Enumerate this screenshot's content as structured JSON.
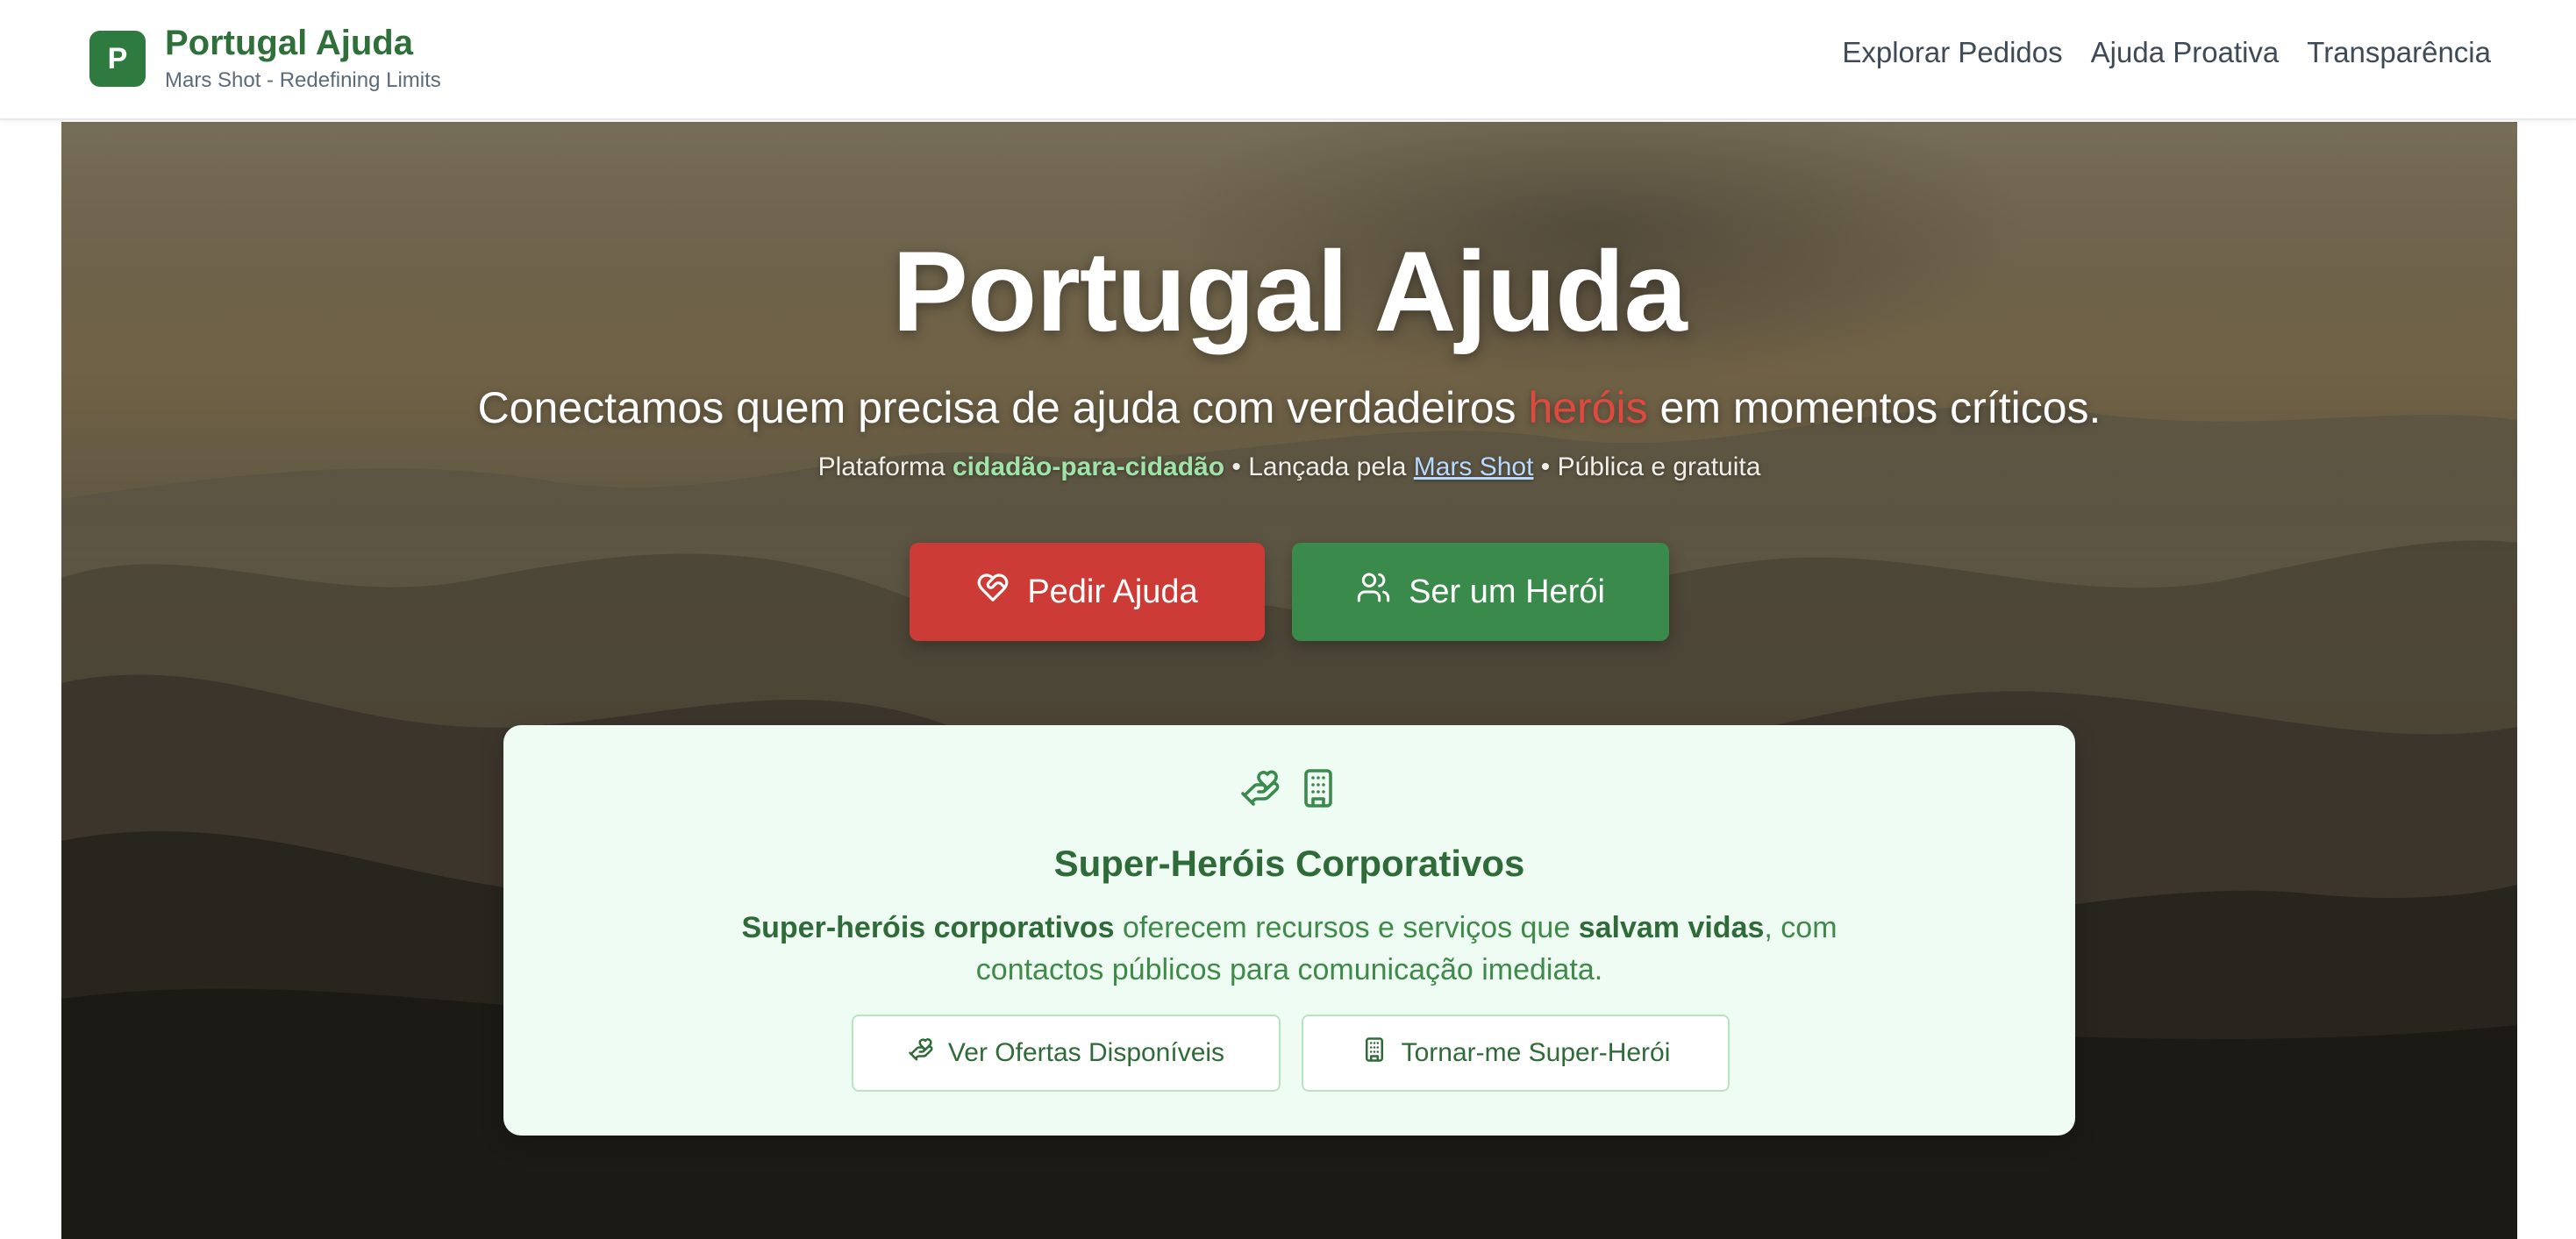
{
  "header": {
    "logo_letter": "P",
    "brand_title": "Portugal Ajuda",
    "brand_subtitle": "Mars Shot - Redefining Limits",
    "nav": [
      "Explorar Pedidos",
      "Ajuda Proativa",
      "Transparência"
    ]
  },
  "hero": {
    "title": "Portugal Ajuda",
    "subtitle_before": "Conectamos quem precisa de ajuda com verdadeiros ",
    "subtitle_highlight": "heróis",
    "subtitle_after": " em momentos críticos.",
    "meta_prefix": "Plataforma ",
    "meta_highlight": "cidadão-para-cidadão",
    "meta_middle": " • Lançada pela ",
    "meta_link": "Mars Shot",
    "meta_suffix": " • Pública e gratuita",
    "primary_button": "Pedir Ajuda",
    "secondary_button": "Ser um Herói"
  },
  "corporate": {
    "title": "Super-Heróis Corporativos",
    "desc_bold_1": "Super-heróis corporativos",
    "desc_text_1": " oferecem recursos e serviços que ",
    "desc_bold_2": "salvam vidas",
    "desc_text_2": ", com contactos públicos para comunicação imediata.",
    "button_offers": "Ver Ofertas Disponíveis",
    "button_join": "Tornar-me Super-Herói"
  },
  "colors": {
    "brand_green": "#2f7a3e",
    "danger_red": "#cc3b35",
    "card_bg": "#effcf3"
  },
  "icons": {
    "heart_handshake": "heart-handshake-icon",
    "users": "users-icon",
    "hand_coins": "hand-coins-icon",
    "building": "building-icon"
  }
}
